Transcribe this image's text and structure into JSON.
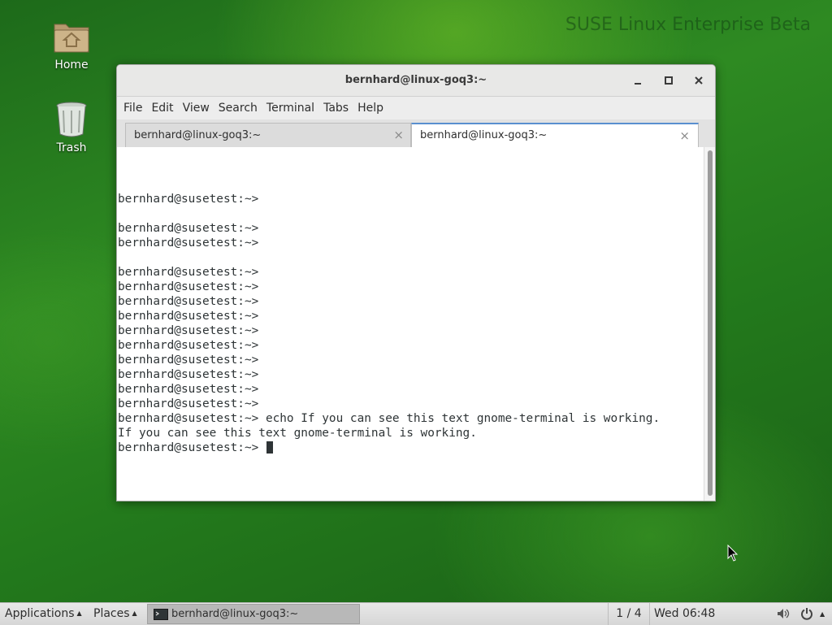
{
  "desktop": {
    "watermark": "SUSE Linux Enterprise Beta",
    "icons": [
      {
        "label": "Home",
        "icon": "home-folder-icon"
      },
      {
        "label": "Trash",
        "icon": "trash-icon"
      }
    ]
  },
  "window": {
    "title": "bernhard@linux-goq3:~",
    "controls": [
      "minimize-icon",
      "maximize-icon",
      "close-icon"
    ],
    "menu": [
      "File",
      "Edit",
      "View",
      "Search",
      "Terminal",
      "Tabs",
      "Help"
    ],
    "tabs": [
      {
        "label": "bernhard@linux-goq3:~",
        "active": false,
        "close": "×"
      },
      {
        "label": "bernhard@linux-goq3:~",
        "active": true,
        "close": "×"
      }
    ],
    "terminal_lines": [
      "bernhard@susetest:~>",
      "",
      "bernhard@susetest:~>",
      "bernhard@susetest:~>",
      "",
      "bernhard@susetest:~>",
      "bernhard@susetest:~>",
      "bernhard@susetest:~>",
      "bernhard@susetest:~>",
      "bernhard@susetest:~>",
      "bernhard@susetest:~>",
      "bernhard@susetest:~>",
      "bernhard@susetest:~>",
      "bernhard@susetest:~>",
      "bernhard@susetest:~>",
      "bernhard@susetest:~> echo If you can see this text gnome-terminal is working.",
      "If you can see this text gnome-terminal is working."
    ],
    "prompt": "bernhard@susetest:~> "
  },
  "taskbar": {
    "applications": "Applications",
    "places": "Places",
    "task_label": "bernhard@linux-goq3:~",
    "workspace": "1 / 4",
    "clock": "Wed 06:48",
    "icons": [
      "volume-icon",
      "power-icon"
    ]
  },
  "colors": {
    "tab_accent": "#5a8fd0",
    "terminal_text": "#2e3436",
    "desktop_green": "#2e8a22"
  }
}
